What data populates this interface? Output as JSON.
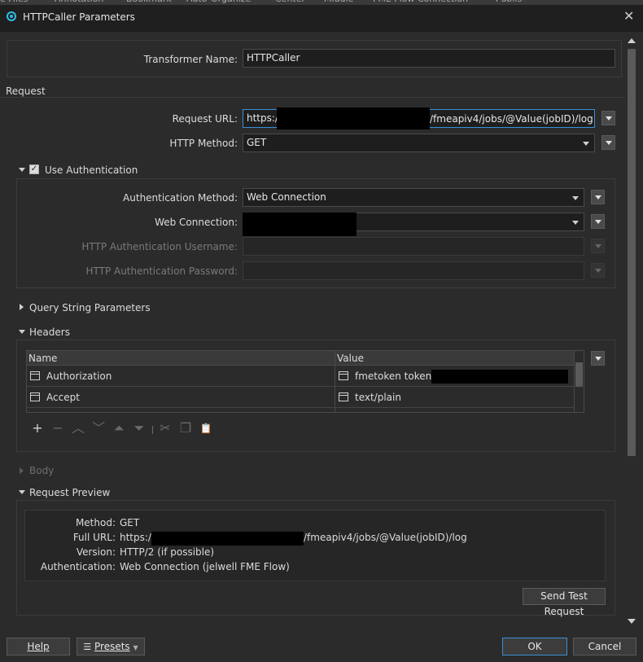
{
  "window": {
    "title": "HTTPCaller Parameters",
    "close": "✕"
  },
  "transformer": {
    "label": "Transformer Name:",
    "value": "HTTPCaller"
  },
  "request": {
    "section": "Request",
    "url_label": "Request URL:",
    "url_prefix": "https://",
    "url_suffix": "/fmeapiv4/jobs/@Value(jobID)/log",
    "method_label": "HTTP Method:",
    "method_value": "GET"
  },
  "auth": {
    "section": "Use Authentication",
    "checked": "✓",
    "method_label": "Authentication Method:",
    "method_value": "Web Connection",
    "connection_label": "Web Connection:",
    "username_label": "HTTP Authentication Username:",
    "password_label": "HTTP Authentication Password:"
  },
  "query": {
    "section": "Query String Parameters"
  },
  "headers": {
    "section": "Headers",
    "columns": [
      "Name",
      "Value"
    ],
    "rows": [
      {
        "name": "Authorization",
        "value": "fmetoken token="
      },
      {
        "name": "Accept",
        "value": "text/plain"
      }
    ]
  },
  "toolbar": {
    "add": "+",
    "remove": "−",
    "up": "︿",
    "down": "﹀",
    "top": "⏶",
    "bottom": "⏷",
    "cut": "✂",
    "copy": "❐",
    "paste": "📋"
  },
  "body": {
    "section": "Body"
  },
  "preview": {
    "section": "Request Preview",
    "method_label": "Method:",
    "method_value": "GET",
    "url_label": "Full URL:",
    "url_prefix": "https://",
    "url_suffix": "/fmeapiv4/jobs/@Value(jobID)/log",
    "version_label": "Version:",
    "version_value": "HTTP/2 (if possible)",
    "auth_label": "Authentication:",
    "auth_value": "Web Connection (jelwell FME Flow)",
    "test_button": "Send Test Request"
  },
  "footer": {
    "help": "Help",
    "presets": "Presets",
    "ok": "OK",
    "cancel": "Cancel"
  },
  "top_strip": {
    "items": [
      "e Files",
      "Annotation",
      "Bookmark",
      "Auto-Organize",
      "Center",
      "Middle",
      "FME Flow Connection",
      "Publis"
    ]
  }
}
